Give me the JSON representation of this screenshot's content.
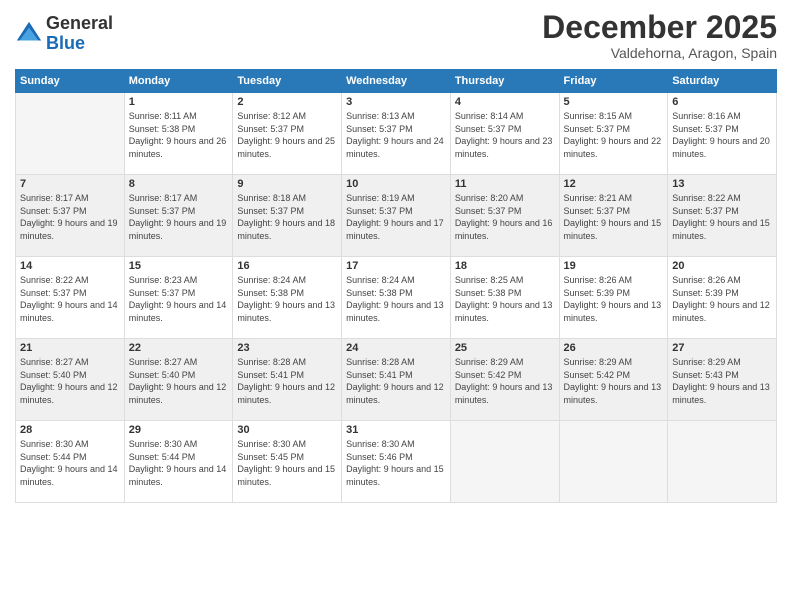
{
  "logo": {
    "line1": "General",
    "line2": "Blue"
  },
  "title": {
    "month_year": "December 2025",
    "location": "Valdehorna, Aragon, Spain"
  },
  "weekdays": [
    "Sunday",
    "Monday",
    "Tuesday",
    "Wednesday",
    "Thursday",
    "Friday",
    "Saturday"
  ],
  "weeks": [
    [
      {
        "day": "",
        "sunrise": "",
        "sunset": "",
        "daylight": ""
      },
      {
        "day": "1",
        "sunrise": "Sunrise: 8:11 AM",
        "sunset": "Sunset: 5:38 PM",
        "daylight": "Daylight: 9 hours and 26 minutes."
      },
      {
        "day": "2",
        "sunrise": "Sunrise: 8:12 AM",
        "sunset": "Sunset: 5:37 PM",
        "daylight": "Daylight: 9 hours and 25 minutes."
      },
      {
        "day": "3",
        "sunrise": "Sunrise: 8:13 AM",
        "sunset": "Sunset: 5:37 PM",
        "daylight": "Daylight: 9 hours and 24 minutes."
      },
      {
        "day": "4",
        "sunrise": "Sunrise: 8:14 AM",
        "sunset": "Sunset: 5:37 PM",
        "daylight": "Daylight: 9 hours and 23 minutes."
      },
      {
        "day": "5",
        "sunrise": "Sunrise: 8:15 AM",
        "sunset": "Sunset: 5:37 PM",
        "daylight": "Daylight: 9 hours and 22 minutes."
      },
      {
        "day": "6",
        "sunrise": "Sunrise: 8:16 AM",
        "sunset": "Sunset: 5:37 PM",
        "daylight": "Daylight: 9 hours and 20 minutes."
      }
    ],
    [
      {
        "day": "7",
        "sunrise": "Sunrise: 8:17 AM",
        "sunset": "Sunset: 5:37 PM",
        "daylight": "Daylight: 9 hours and 19 minutes."
      },
      {
        "day": "8",
        "sunrise": "Sunrise: 8:17 AM",
        "sunset": "Sunset: 5:37 PM",
        "daylight": "Daylight: 9 hours and 19 minutes."
      },
      {
        "day": "9",
        "sunrise": "Sunrise: 8:18 AM",
        "sunset": "Sunset: 5:37 PM",
        "daylight": "Daylight: 9 hours and 18 minutes."
      },
      {
        "day": "10",
        "sunrise": "Sunrise: 8:19 AM",
        "sunset": "Sunset: 5:37 PM",
        "daylight": "Daylight: 9 hours and 17 minutes."
      },
      {
        "day": "11",
        "sunrise": "Sunrise: 8:20 AM",
        "sunset": "Sunset: 5:37 PM",
        "daylight": "Daylight: 9 hours and 16 minutes."
      },
      {
        "day": "12",
        "sunrise": "Sunrise: 8:21 AM",
        "sunset": "Sunset: 5:37 PM",
        "daylight": "Daylight: 9 hours and 15 minutes."
      },
      {
        "day": "13",
        "sunrise": "Sunrise: 8:22 AM",
        "sunset": "Sunset: 5:37 PM",
        "daylight": "Daylight: 9 hours and 15 minutes."
      }
    ],
    [
      {
        "day": "14",
        "sunrise": "Sunrise: 8:22 AM",
        "sunset": "Sunset: 5:37 PM",
        "daylight": "Daylight: 9 hours and 14 minutes."
      },
      {
        "day": "15",
        "sunrise": "Sunrise: 8:23 AM",
        "sunset": "Sunset: 5:37 PM",
        "daylight": "Daylight: 9 hours and 14 minutes."
      },
      {
        "day": "16",
        "sunrise": "Sunrise: 8:24 AM",
        "sunset": "Sunset: 5:38 PM",
        "daylight": "Daylight: 9 hours and 13 minutes."
      },
      {
        "day": "17",
        "sunrise": "Sunrise: 8:24 AM",
        "sunset": "Sunset: 5:38 PM",
        "daylight": "Daylight: 9 hours and 13 minutes."
      },
      {
        "day": "18",
        "sunrise": "Sunrise: 8:25 AM",
        "sunset": "Sunset: 5:38 PM",
        "daylight": "Daylight: 9 hours and 13 minutes."
      },
      {
        "day": "19",
        "sunrise": "Sunrise: 8:26 AM",
        "sunset": "Sunset: 5:39 PM",
        "daylight": "Daylight: 9 hours and 13 minutes."
      },
      {
        "day": "20",
        "sunrise": "Sunrise: 8:26 AM",
        "sunset": "Sunset: 5:39 PM",
        "daylight": "Daylight: 9 hours and 12 minutes."
      }
    ],
    [
      {
        "day": "21",
        "sunrise": "Sunrise: 8:27 AM",
        "sunset": "Sunset: 5:40 PM",
        "daylight": "Daylight: 9 hours and 12 minutes."
      },
      {
        "day": "22",
        "sunrise": "Sunrise: 8:27 AM",
        "sunset": "Sunset: 5:40 PM",
        "daylight": "Daylight: 9 hours and 12 minutes."
      },
      {
        "day": "23",
        "sunrise": "Sunrise: 8:28 AM",
        "sunset": "Sunset: 5:41 PM",
        "daylight": "Daylight: 9 hours and 12 minutes."
      },
      {
        "day": "24",
        "sunrise": "Sunrise: 8:28 AM",
        "sunset": "Sunset: 5:41 PM",
        "daylight": "Daylight: 9 hours and 12 minutes."
      },
      {
        "day": "25",
        "sunrise": "Sunrise: 8:29 AM",
        "sunset": "Sunset: 5:42 PM",
        "daylight": "Daylight: 9 hours and 13 minutes."
      },
      {
        "day": "26",
        "sunrise": "Sunrise: 8:29 AM",
        "sunset": "Sunset: 5:42 PM",
        "daylight": "Daylight: 9 hours and 13 minutes."
      },
      {
        "day": "27",
        "sunrise": "Sunrise: 8:29 AM",
        "sunset": "Sunset: 5:43 PM",
        "daylight": "Daylight: 9 hours and 13 minutes."
      }
    ],
    [
      {
        "day": "28",
        "sunrise": "Sunrise: 8:30 AM",
        "sunset": "Sunset: 5:44 PM",
        "daylight": "Daylight: 9 hours and 14 minutes."
      },
      {
        "day": "29",
        "sunrise": "Sunrise: 8:30 AM",
        "sunset": "Sunset: 5:44 PM",
        "daylight": "Daylight: 9 hours and 14 minutes."
      },
      {
        "day": "30",
        "sunrise": "Sunrise: 8:30 AM",
        "sunset": "Sunset: 5:45 PM",
        "daylight": "Daylight: 9 hours and 15 minutes."
      },
      {
        "day": "31",
        "sunrise": "Sunrise: 8:30 AM",
        "sunset": "Sunset: 5:46 PM",
        "daylight": "Daylight: 9 hours and 15 minutes."
      },
      {
        "day": "",
        "sunrise": "",
        "sunset": "",
        "daylight": ""
      },
      {
        "day": "",
        "sunrise": "",
        "sunset": "",
        "daylight": ""
      },
      {
        "day": "",
        "sunrise": "",
        "sunset": "",
        "daylight": ""
      }
    ]
  ]
}
